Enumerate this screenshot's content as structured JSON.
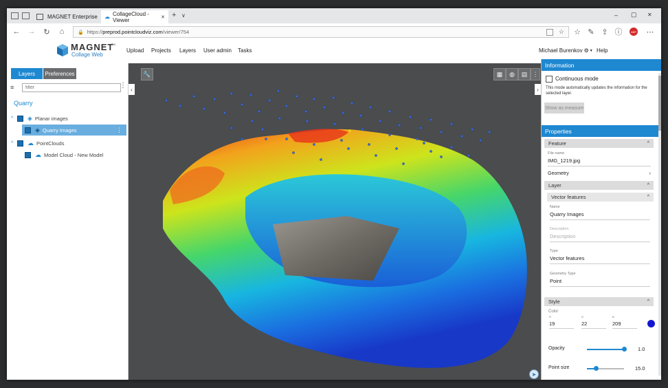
{
  "browser": {
    "tabs": [
      {
        "title": "MAGNET Enterprise"
      },
      {
        "title": "CollageCloud - Viewer"
      }
    ],
    "new_tab": "+",
    "tab_menu": "∨",
    "url_prefix": "https://",
    "url_host": "preprod.pointcloudviz.com",
    "url_path": "/viewer/754",
    "window_controls": {
      "minimize": "–",
      "maximize": "▢",
      "close": "✕"
    },
    "more": "⋯",
    "abp_badge": "ABP"
  },
  "app": {
    "logo_main": "MAGNET",
    "logo_tm": "TM",
    "logo_sub": "Collage Web",
    "menu": [
      "Upload",
      "Projects",
      "Layers",
      "User admin",
      "Tasks"
    ],
    "user": "Michael Burenkov",
    "user_gear": "⚙",
    "help": "Help"
  },
  "left_panel": {
    "tabs": [
      "Layers",
      "Preferences"
    ],
    "filter_placeholder": "filter",
    "project": "Quarry",
    "tree": [
      {
        "label": "Planar images",
        "level": 0,
        "expanded": true
      },
      {
        "label": "Quarry Images",
        "level": 1,
        "selected": true
      },
      {
        "label": "PointClouds",
        "level": 0,
        "expanded": true
      },
      {
        "label": "Model Cloud - New Model",
        "level": 1
      }
    ]
  },
  "viewer": {
    "tools_icon": "wrench-icon",
    "toolbar_icons": [
      "grid-icon",
      "globe-icon",
      "layers-cube-icon",
      "more-vertical-icon"
    ],
    "compass_icon": "compass-icon"
  },
  "right_panel": {
    "information": {
      "title": "Information",
      "continuous_mode_label": "Continuous mode",
      "continuous_mode_checked": false,
      "description": "This mode automatically updates the information for the selected layer.",
      "show_measure": "Show as measure"
    },
    "properties": {
      "title": "Properties",
      "feature_section": "Feature",
      "file_name_label": "File name",
      "file_name": "IMG_1219.jpg",
      "geometry_label": "Geometry",
      "layer_section": "Layer",
      "vector_section": "Vector features",
      "name_label": "Name",
      "name_value": "Quarry Images",
      "description_label": "Description",
      "description_placeholder": "Description",
      "type_label": "Type",
      "type_value": "Vector features",
      "geometry_type_label": "Geometry Type",
      "geometry_type_value": "Point",
      "style_section": "Style",
      "color_label": "Color",
      "color_channels": [
        {
          "label": "R",
          "value": "19"
        },
        {
          "label": "G",
          "value": "22"
        },
        {
          "label": "B",
          "value": "209"
        }
      ],
      "color_swatch": "#1316d1",
      "opacity_label": "Opacity",
      "opacity_value": "1.0",
      "opacity_fraction": 1.0,
      "point_size_label": "Point size",
      "point_size_value": "15.0",
      "point_size_fraction": 0.25
    }
  },
  "colors": {
    "accent": "#1e88d1",
    "viewer_bg": "#4a4c4e",
    "point_color": "#1316d1"
  }
}
